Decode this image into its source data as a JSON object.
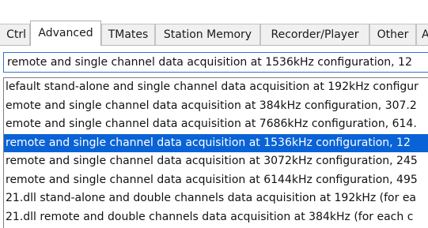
{
  "tabs": [
    {
      "label": "Ctrl"
    },
    {
      "label": "Advanced",
      "active": true
    },
    {
      "label": "TMates"
    },
    {
      "label": "Station Memory"
    },
    {
      "label": "Recorder/Player"
    },
    {
      "label": "Other"
    },
    {
      "label": "A"
    }
  ],
  "combo": {
    "value": "remote and single channel data acquisition at 1536kHz configuration, 12"
  },
  "dropdown": {
    "options": [
      {
        "label": "lefault stand-alone and single channel data acquisition at 192kHz configur"
      },
      {
        "label": "emote and single channel data acquisition at 384kHz configuration, 307.2"
      },
      {
        "label": "emote and single channel data acquisition at 7686kHz configuration, 614."
      },
      {
        "label": "remote and single channel data acquisition at 1536kHz configuration, 12",
        "selected": true
      },
      {
        "label": "remote and single channel data acquisition at 3072kHz configuration, 245"
      },
      {
        "label": "remote and single channel data acquisition at 6144kHz configuration, 495"
      },
      {
        "label": "21.dll stand-alone and double channels data acquisition at 192kHz (for ea"
      },
      {
        "label": "21.dll remote and double channels data acquisition at 384kHz (for each c"
      }
    ]
  },
  "colors": {
    "selection": "#0a63d6",
    "focus_border": "#2f72d6"
  }
}
